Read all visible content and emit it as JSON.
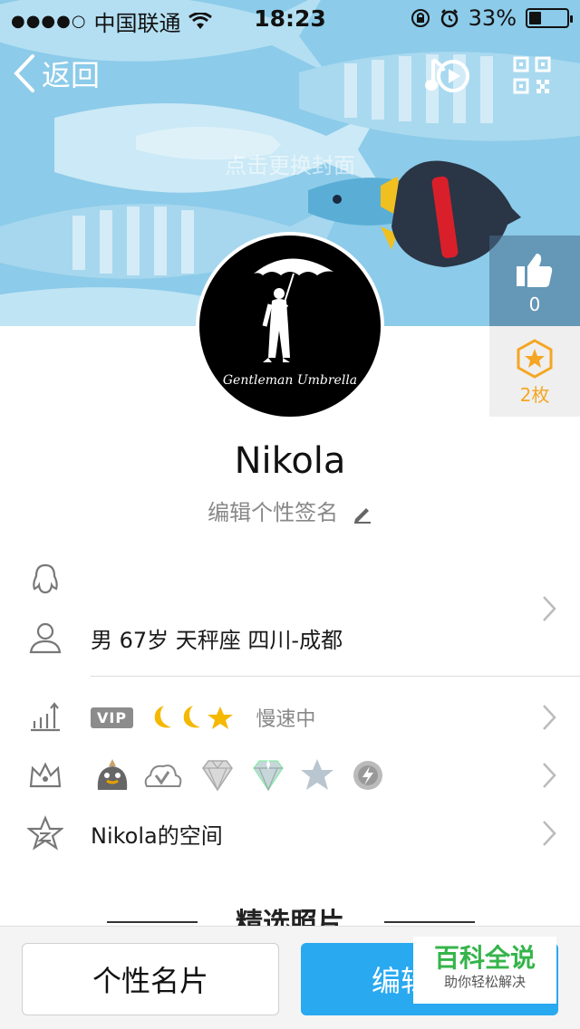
{
  "status_bar": {
    "signal": "●●●●○",
    "carrier": "中国联通",
    "time": "18:23",
    "battery": "33%",
    "battery_level": 0.33
  },
  "nav": {
    "back_label": "返回",
    "music_icon": "music-play-icon",
    "qr_icon": "qr-code-icon"
  },
  "cover": {
    "hint": "点击更换封面"
  },
  "likes": {
    "count": "0",
    "icon": "thumbs-up-icon"
  },
  "badges": {
    "count": "2枚",
    "icon": "star-badge-icon"
  },
  "avatar": {
    "caption": "Gentleman Umbrella"
  },
  "profile": {
    "nickname": "Nikola",
    "signature": "编辑个性签名"
  },
  "info": {
    "basic": "男  67岁  天秤座  四川-成都",
    "vip_tag": "VIP",
    "level_icons": [
      "moon-icon",
      "moon-icon",
      "star-icon"
    ],
    "speed": "慢速中",
    "service_icons": [
      "qq-penguin-icon",
      "weiyun-icon",
      "diamond-icon",
      "blue-diamond-icon",
      "star-icon",
      "lightning-icon"
    ],
    "space": "Nikola的空间"
  },
  "section": {
    "title": "精选照片"
  },
  "bottom": {
    "card_label": "个性名片",
    "edit_label": "编辑资料"
  },
  "watermark": {
    "title": "百科全说",
    "subtitle": "助你轻松解决"
  },
  "colors": {
    "primary_blue": "#29a9f0",
    "cover_blue": "#7fc6e6",
    "badge_gold": "#f5a623",
    "watermark_green": "#35b44a"
  }
}
